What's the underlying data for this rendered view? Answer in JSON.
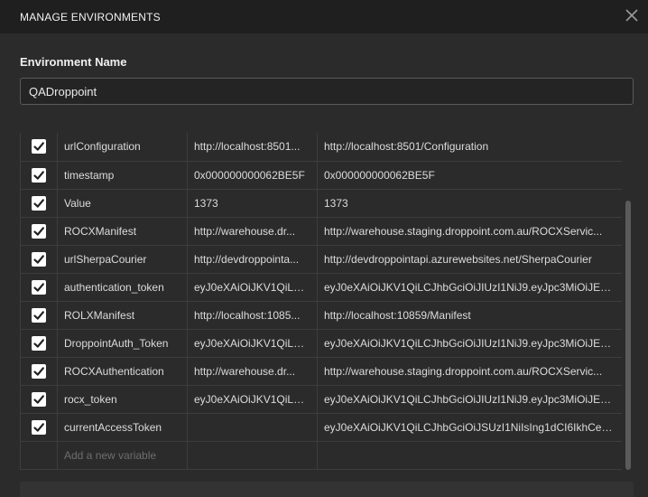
{
  "dialog": {
    "title": "MANAGE ENVIRONMENTS"
  },
  "environment": {
    "label": "Environment Name",
    "value": "QADroppoint"
  },
  "variables": [
    {
      "key": "urlConfiguration",
      "initial": "http://localhost:8501...",
      "current": "http://localhost:8501/Configuration",
      "enabled": true
    },
    {
      "key": "timestamp",
      "initial": "0x000000000062BE5F",
      "current": "0x000000000062BE5F",
      "enabled": true
    },
    {
      "key": "Value",
      "initial": "1373",
      "current": "1373",
      "enabled": true
    },
    {
      "key": "ROCXManifest",
      "initial": "http://warehouse.dr...",
      "current": "http://warehouse.staging.droppoint.com.au/ROCXServic...",
      "enabled": true
    },
    {
      "key": "urlSherpaCourier",
      "initial": "http://devdroppointa...",
      "current": "http://devdroppointapi.azurewebsites.net/SherpaCourier",
      "enabled": true
    },
    {
      "key": "authentication_token",
      "initial": "eyJ0eXAiOiJKV1QiLCJ...",
      "current": "eyJ0eXAiOiJKV1QiLCJhbGciOiJIUzI1NiJ9.eyJpc3MiOiJEcm9...",
      "enabled": true
    },
    {
      "key": "ROLXManifest",
      "initial": "http://localhost:1085...",
      "current": "http://localhost:10859/Manifest",
      "enabled": true
    },
    {
      "key": "DroppointAuth_Token",
      "initial": "eyJ0eXAiOiJKV1QiLCJ...",
      "current": "eyJ0eXAiOiJKV1QiLCJhbGciOiJIUzI1NiJ9.eyJpc3MiOiJEcm9...",
      "enabled": true
    },
    {
      "key": "ROCXAuthentication",
      "initial": "http://warehouse.dr...",
      "current": "http://warehouse.staging.droppoint.com.au/ROCXServic...",
      "enabled": true
    },
    {
      "key": "rocx_token",
      "initial": "eyJ0eXAiOiJKV1QiLCJ...",
      "current": "eyJ0eXAiOiJKV1QiLCJhbGciOiJIUzI1NiJ9.eyJpc3MiOiJEcm9...",
      "enabled": true
    },
    {
      "key": "currentAccessToken",
      "initial": "",
      "current": "eyJ0eXAiOiJKV1QiLCJhbGciOiJSUzI1NiIsIng1dCI6IkhCeGw...",
      "enabled": true
    }
  ],
  "new_variable_placeholder": "Add a new variable",
  "icons": {
    "close": "close-icon",
    "check": "checkmark-icon"
  },
  "colors": {
    "background": "#2b2b2b",
    "titlebar": "#1f1f1f",
    "checkbox": "#ffffff"
  }
}
